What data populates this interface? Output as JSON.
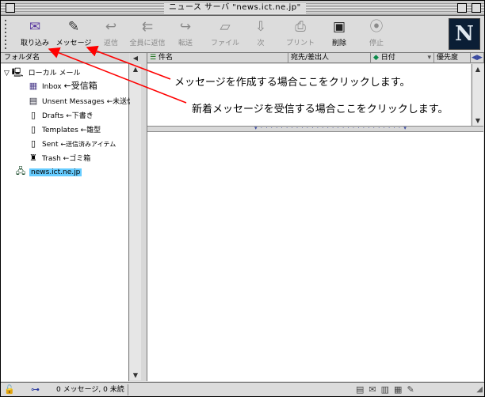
{
  "window": {
    "title": "ニュース サーバ \"news.ict.ne.jp\""
  },
  "toolbar": {
    "buttons": [
      {
        "label": "取り込み",
        "icon": "get-mail-icon",
        "enabled": true
      },
      {
        "label": "メッセージ",
        "icon": "new-message-icon",
        "enabled": true
      },
      {
        "label": "返信",
        "icon": "reply-icon",
        "enabled": false
      },
      {
        "label": "全員に返信",
        "icon": "reply-all-icon",
        "enabled": false
      },
      {
        "label": "転送",
        "icon": "forward-icon",
        "enabled": false
      },
      {
        "label": "ファイル",
        "icon": "file-icon",
        "enabled": false
      },
      {
        "label": "次",
        "icon": "next-icon",
        "enabled": false
      },
      {
        "label": "プリント",
        "icon": "print-icon",
        "enabled": false
      },
      {
        "label": "削除",
        "icon": "delete-icon",
        "enabled": true
      },
      {
        "label": "停止",
        "icon": "stop-icon",
        "enabled": false
      }
    ],
    "logo": "N"
  },
  "folders": {
    "header": "フォルダ名",
    "group": "ローカル メール",
    "items": [
      {
        "name": "Inbox",
        "note": "←受信箱",
        "icon": "inbox-icon"
      },
      {
        "name": "Unsent Messages",
        "note": "←未送信メール",
        "icon": "unsent-icon"
      },
      {
        "name": "Drafts",
        "note": "←下書き",
        "icon": "drafts-icon"
      },
      {
        "name": "Templates",
        "note": "←雛型",
        "icon": "templates-icon"
      },
      {
        "name": "Sent",
        "note": "←送信済みアイテム",
        "icon": "sent-icon"
      },
      {
        "name": "Trash",
        "note": "←ゴミ箱",
        "icon": "trash-icon"
      }
    ],
    "news_server": "news.ict.ne.jp"
  },
  "columns": {
    "subject": "件名",
    "sender": "宛先/差出人",
    "date": "日付",
    "priority": "優先度"
  },
  "status": {
    "text": "0 メッセージ, 0 未読"
  },
  "annotations": {
    "compose": "メッセージを作成する場合ここをクリックします。",
    "receive": "新着メッセージを受信する場合ここをクリックします。"
  },
  "colors": {
    "arrow": "#ff0000",
    "selection": "#66ccff",
    "logo_bg": "#0b1e35"
  }
}
